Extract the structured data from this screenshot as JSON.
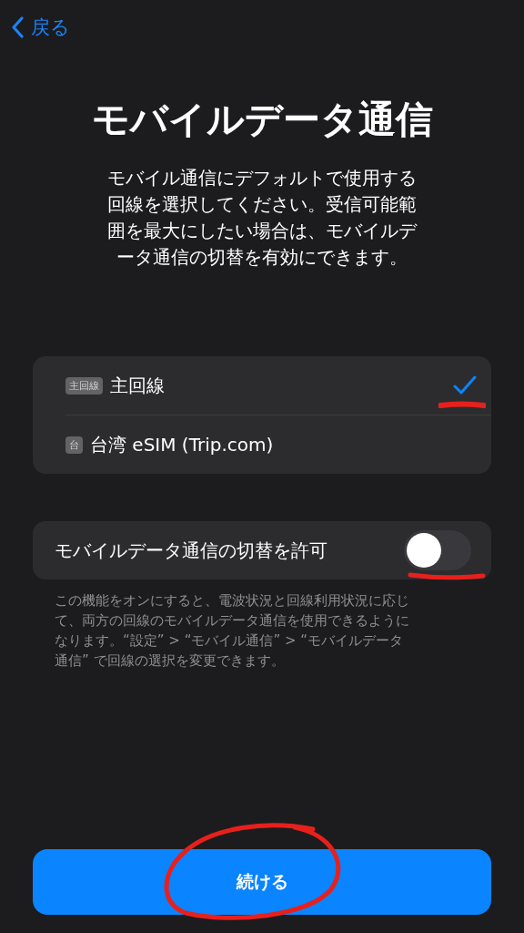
{
  "nav": {
    "back_label": "戻る"
  },
  "title": "モバイルデータ通信",
  "description": "モバイル通信にデフォルトで使用する回線を選択してください。受信可能範囲を最大にしたい場合は、モバイルデータ通信の切替を有効にできます。",
  "lines": [
    {
      "badge": "主回線",
      "label": "主回線",
      "selected": true
    },
    {
      "badge": "台",
      "label": "台湾 eSIM (Trip.com)",
      "selected": false
    }
  ],
  "switching": {
    "label": "モバイルデータ通信の切替を許可",
    "on": false
  },
  "footnote": "この機能をオンにすると、電波状況と回線利用状況に応じて、両方の回線のモバイルデータ通信を使用できるようになります。“設定” > “モバイル通信” > “モバイルデータ通信” で回線の選択を変更できます。",
  "continue_button": "続ける"
}
